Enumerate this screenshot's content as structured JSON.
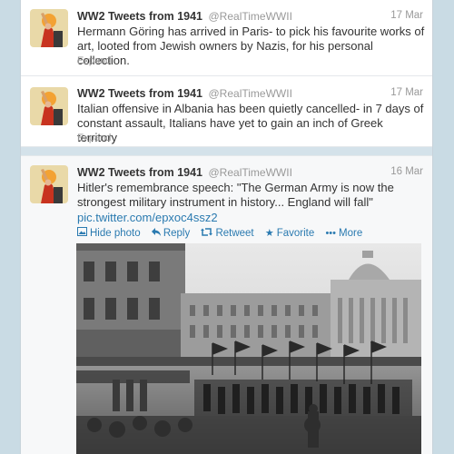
{
  "tweets": [
    {
      "name": "WW2 Tweets from 1941",
      "handle": "@RealTimeWWII",
      "date": "17 Mar",
      "text": "Hermann Göring has arrived in Paris- to pick his favourite works of art, looted from Jewish owners by Nazis, for his personal collection.",
      "expand": "Expand"
    },
    {
      "name": "WW2 Tweets from 1941",
      "handle": "@RealTimeWWII",
      "date": "17 Mar",
      "text": "Italian offensive in Albania has been quietly cancelled- in 7 days of constant assault, Italians have yet to gain an inch of Greek territory",
      "expand": "Expand"
    },
    {
      "name": "WW2 Tweets from 1941",
      "handle": "@RealTimeWWII",
      "date": "16 Mar",
      "text": "Hitler's remembrance speech: \"The German Army is now the strongest military instrument in history... England will fall\"",
      "link": "pic.twitter.com/epxoc4ssz2",
      "actions": {
        "hide_photo": "Hide photo",
        "reply": "Reply",
        "retweet": "Retweet",
        "favorite": "Favorite",
        "more": "More"
      }
    }
  ],
  "colors": {
    "link": "#2a7ab0",
    "meta": "#999999",
    "text": "#333333",
    "background": "#c9dbe4"
  },
  "icons": {
    "avatar": "poster-woman-arm-raised",
    "hide_photo": "image-icon",
    "reply": "reply-arrow-icon",
    "retweet": "retweet-icon",
    "favorite": "star-icon",
    "more": "dots-icon"
  }
}
